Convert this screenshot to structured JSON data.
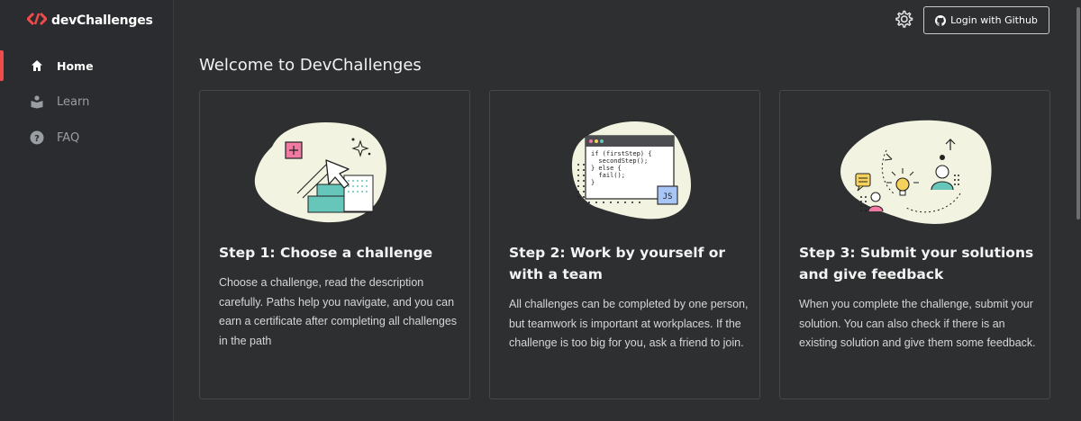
{
  "app": {
    "logo_text": "devChallenges"
  },
  "sidebar": {
    "items": [
      {
        "label": "Home",
        "icon": "home-icon",
        "active": true
      },
      {
        "label": "Learn",
        "icon": "learn-icon",
        "active": false
      },
      {
        "label": "FAQ",
        "icon": "help-icon",
        "active": false
      }
    ]
  },
  "header": {
    "settings_icon": "gear-icon",
    "login_label": "Login with Github",
    "login_icon": "github-icon"
  },
  "main": {
    "title": "Welcome to DevChallenges",
    "cards": [
      {
        "title": "Step 1: Choose a challenge",
        "body": "Choose a challenge, read the description carefully. Paths help you navigate, and you can earn a certificate after completing all challenges in the path"
      },
      {
        "title": "Step 2: Work by yourself or with a team",
        "body": "All challenges can be completed by one person, but teamwork is important at workplaces. If the challenge is too big for you, ask a friend to join.",
        "code_lines": [
          "if (firstStep) {",
          "  secondStep();",
          "} else {",
          "  fail();",
          "}"
        ],
        "code_badge": "JS"
      },
      {
        "title": "Step 3: Submit your solutions and give feedback",
        "body": "When you complete the challenge, submit your solution. You can also check if there is an existing solution and give them some feedback."
      }
    ]
  },
  "colors": {
    "accent": "#ef4b4b",
    "background": "#2d2f31",
    "sidebar": "#2a2c2f",
    "blob": "#f2f3e1",
    "teal": "#66c6b9"
  }
}
